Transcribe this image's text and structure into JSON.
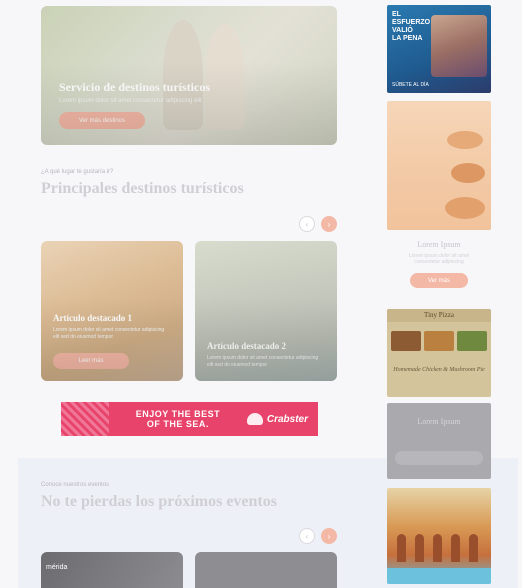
{
  "hero": {
    "title": "Servicio de destinos turísticos",
    "subtitle": "Lorem ipsum dolor sit amet consectetur adipiscing elit",
    "button_label": "Ver más destinos"
  },
  "destinations": {
    "kicker": "¿A qué lugar te gustaría ir?",
    "title": "Principales destinos turísticos",
    "prev_icon": "‹",
    "next_icon": "›",
    "articles": [
      {
        "title": "Artículo destacado 1",
        "description": "Lorem ipsum dolor sit amet consectetur adipiscing elit sed do eiusmod tempor",
        "button_label": "Leer más"
      },
      {
        "title": "Artículo destacado 2",
        "description": "Lorem ipsum dolor sit amet consectetur adipiscing elit sed do eiusmod tempor"
      }
    ]
  },
  "banner": {
    "line1": "ENJOY THE BEST",
    "line2": "OF THE SEA.",
    "brand": "Crabster"
  },
  "events": {
    "kicker": "Conoce nuestros eventos",
    "title": "No te pierdas los próximos eventos",
    "prev_icon": "‹",
    "next_icon": "›",
    "card1_brand": "mérida"
  },
  "sidebar": {
    "ad1": {
      "line1": "EL",
      "line2": "ESFUERZO",
      "line3": "VALIÓ",
      "line4": "LA PENA",
      "footer": "SÚBETE AL DÍA"
    },
    "ad2": {
      "title": "Lorem Ipsum",
      "text": "Lorem ipsum dolor sit amet consectetur adipiscing",
      "button_label": "Ver más"
    },
    "ad3": {
      "header": "Tiny Pizza",
      "body": "Homemade Chicken & Mushroom Pie"
    },
    "ad4": {
      "title": "Lorem Ipsum"
    }
  },
  "colors": {
    "accent": "#f4b8a6",
    "banner": "#e8436a",
    "band": "#eef0f7"
  }
}
